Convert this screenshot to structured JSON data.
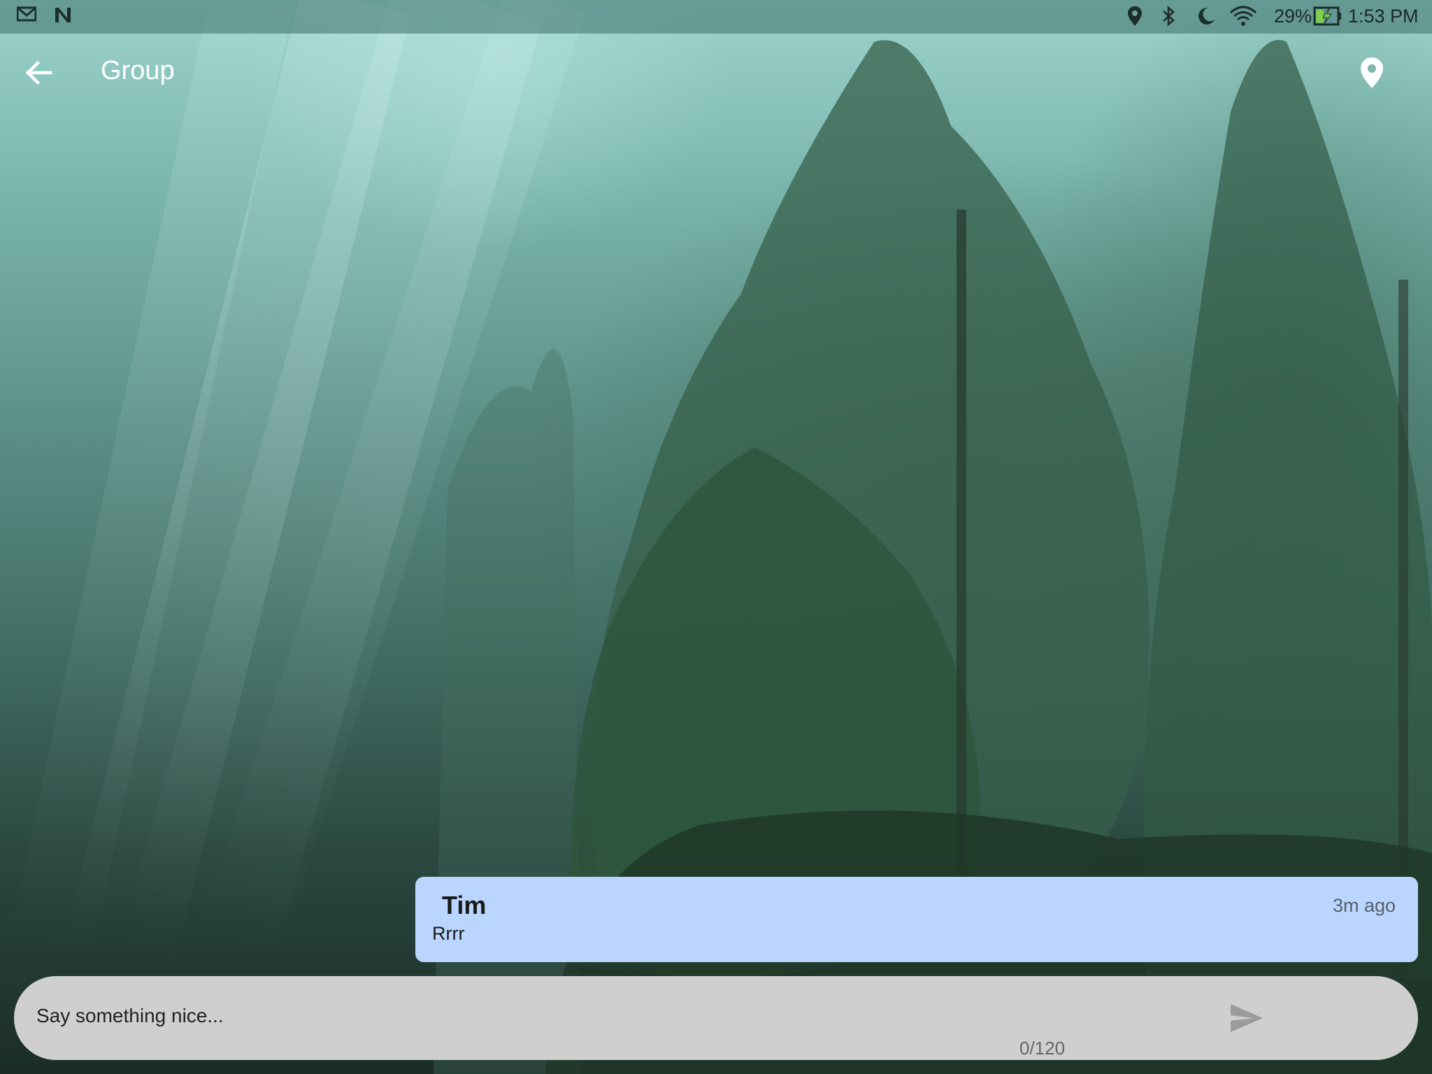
{
  "status_bar": {
    "battery_percent": "29%",
    "time": "1:53 PM",
    "left_icons": [
      "gmail-icon",
      "n-app-icon"
    ],
    "right_icons": [
      "location-icon",
      "bluetooth-icon",
      "do-not-disturb-moon-icon",
      "wifi-icon",
      "battery-charging-icon"
    ]
  },
  "app_bar": {
    "title": "Group",
    "back_icon": "arrow-back-icon",
    "action_icon": "location-pin-icon"
  },
  "messages": [
    {
      "sender": "Tim",
      "time": "3m ago",
      "text": "Rrrr"
    }
  ],
  "composer": {
    "placeholder": "Say something nice...",
    "value": "",
    "counter": "0/120",
    "send_icon": "send-icon"
  },
  "colors": {
    "bubble": "#bad6ff",
    "input_background": "#cfcfcf",
    "title_text": "#ffffff"
  }
}
